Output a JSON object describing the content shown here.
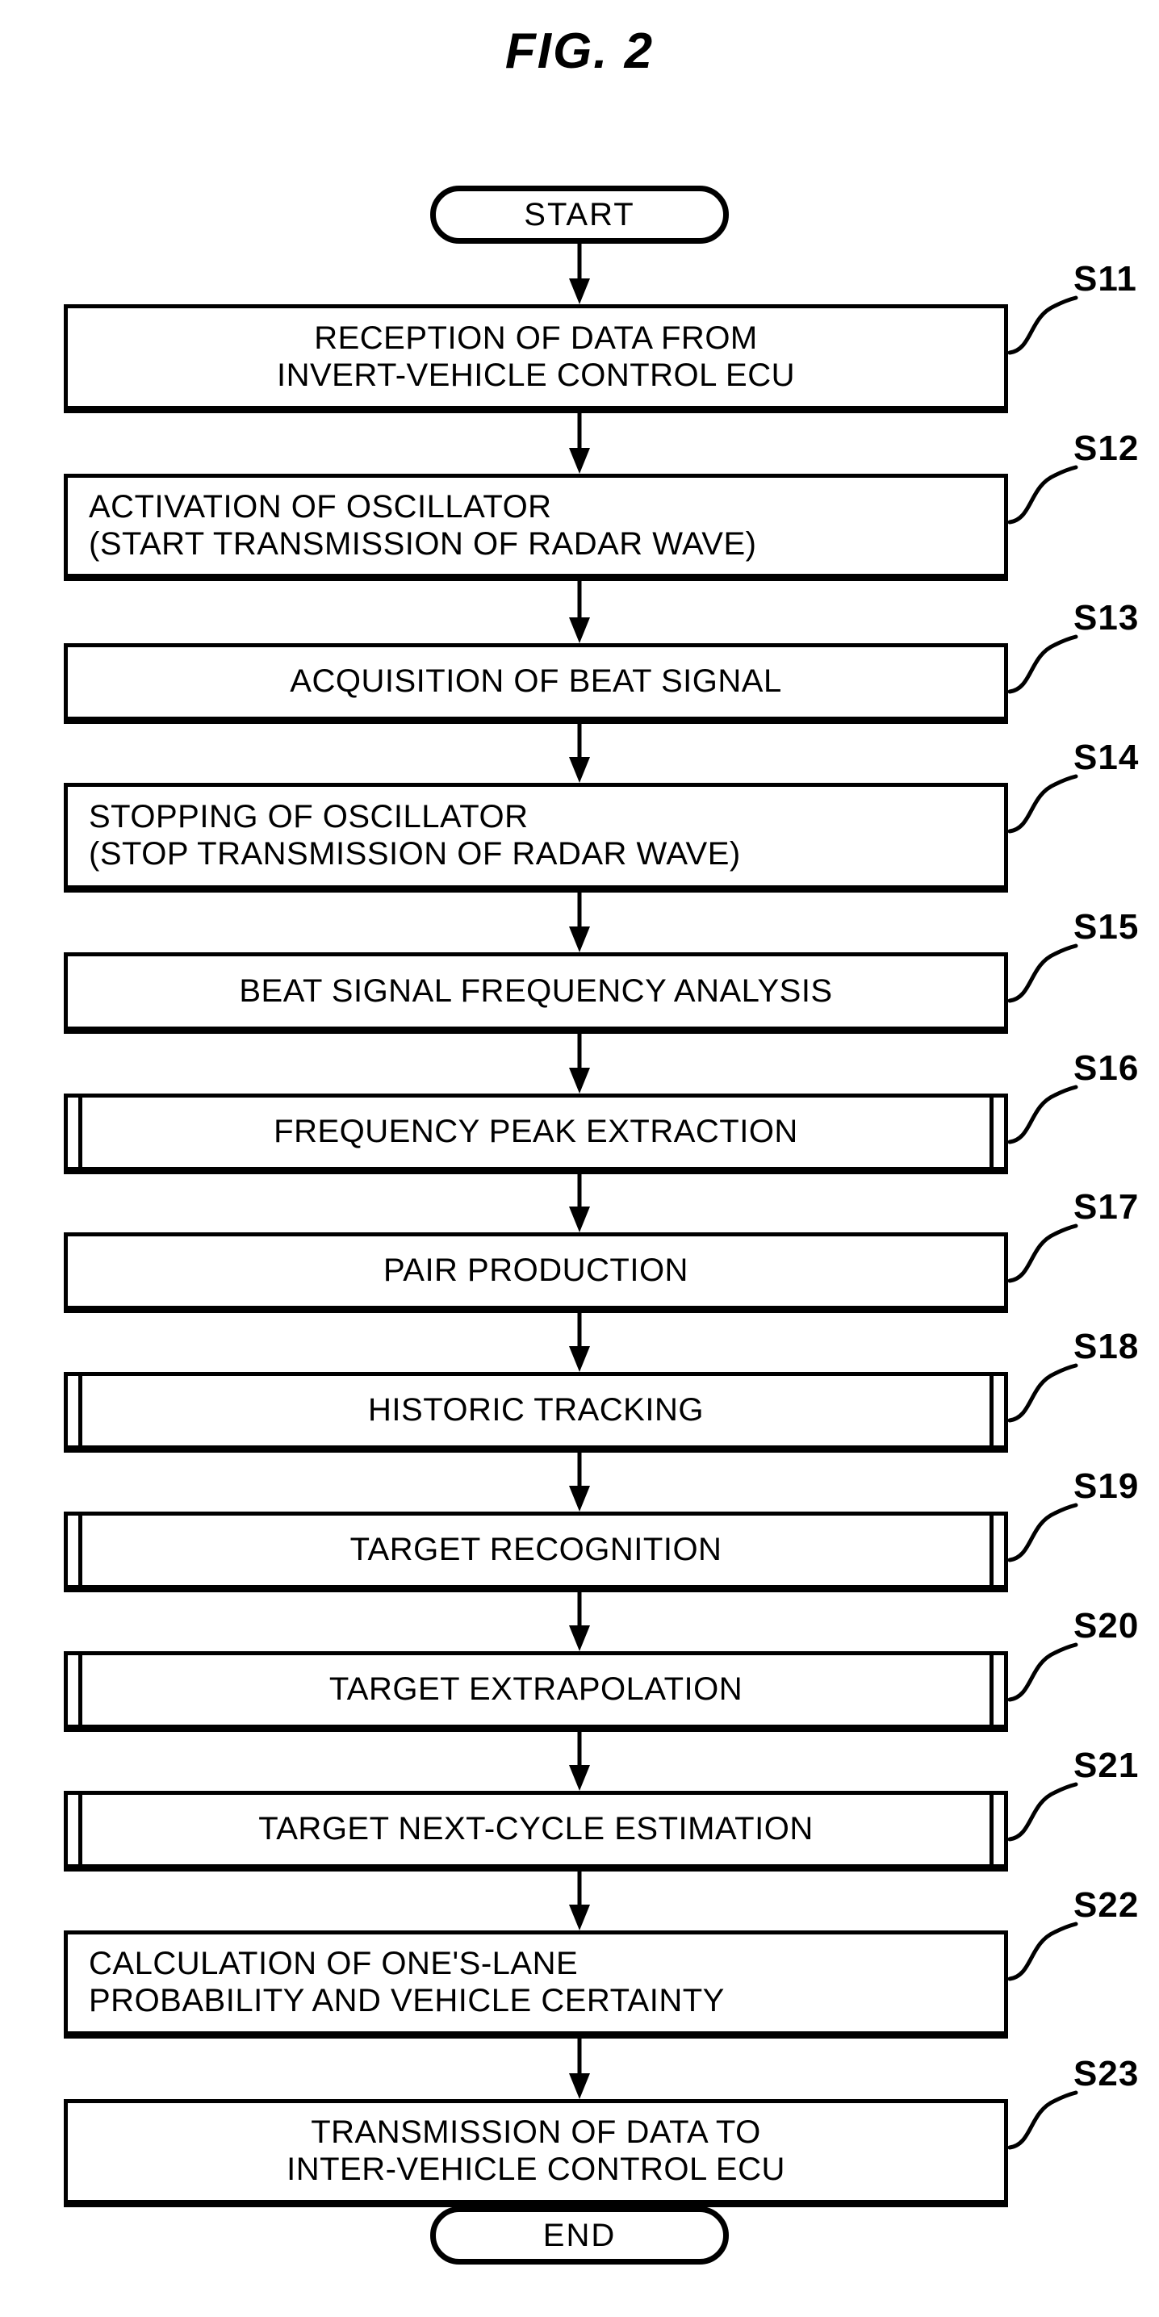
{
  "figure": {
    "title": "FIG.  2",
    "type": "flowchart",
    "start_label": "START",
    "end_label": "END"
  },
  "steps": [
    {
      "ref": "S11",
      "text": "RECEPTION OF DATA FROM\nINVERT-VEHICLE CONTROL ECU",
      "shape": "process",
      "align": "center"
    },
    {
      "ref": "S12",
      "text": "ACTIVATION OF OSCILLATOR\n(START TRANSMISSION OF RADAR WAVE)",
      "shape": "process",
      "align": "left"
    },
    {
      "ref": "S13",
      "text": "ACQUISITION OF BEAT SIGNAL",
      "shape": "process",
      "align": "center"
    },
    {
      "ref": "S14",
      "text": "STOPPING OF OSCILLATOR\n(STOP TRANSMISSION OF RADAR WAVE)",
      "shape": "process",
      "align": "left"
    },
    {
      "ref": "S15",
      "text": "BEAT SIGNAL FREQUENCY ANALYSIS",
      "shape": "process",
      "align": "center"
    },
    {
      "ref": "S16",
      "text": "FREQUENCY PEAK EXTRACTION",
      "shape": "predefined-process",
      "align": "center"
    },
    {
      "ref": "S17",
      "text": "PAIR PRODUCTION",
      "shape": "process",
      "align": "center"
    },
    {
      "ref": "S18",
      "text": "HISTORIC TRACKING",
      "shape": "predefined-process",
      "align": "center"
    },
    {
      "ref": "S19",
      "text": "TARGET RECOGNITION",
      "shape": "predefined-process",
      "align": "center"
    },
    {
      "ref": "S20",
      "text": "TARGET EXTRAPOLATION",
      "shape": "predefined-process",
      "align": "center"
    },
    {
      "ref": "S21",
      "text": "TARGET NEXT-CYCLE ESTIMATION",
      "shape": "predefined-process",
      "align": "center"
    },
    {
      "ref": "S22",
      "text": "CALCULATION OF ONE'S-LANE\nPROBABILITY AND VEHICLE CERTAINTY",
      "shape": "process",
      "align": "left"
    },
    {
      "ref": "S23",
      "text": "TRANSMISSION OF DATA TO\nINTER-VEHICLE CONTROL ECU",
      "shape": "process",
      "align": "center"
    }
  ],
  "colors": {
    "ink": "#000000",
    "paper": "#ffffff"
  }
}
